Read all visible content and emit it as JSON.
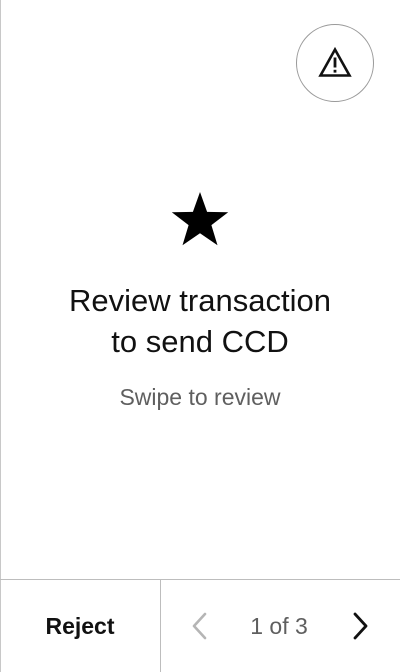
{
  "warning": {
    "icon": "warning-triangle-icon"
  },
  "hero": {
    "icon": "star-icon",
    "title_line1": "Review transaction",
    "title_line2": "to send CCD",
    "subtitle": "Swipe to review"
  },
  "footer": {
    "reject_label": "Reject",
    "prev_icon": "chevron-left-icon",
    "next_icon": "chevron-right-icon",
    "page_indicator": "1 of 3",
    "current_page": 1,
    "total_pages": 3
  },
  "colors": {
    "text": "#111111",
    "muted_text": "#5f5f5f",
    "border": "#bdbdbd",
    "disabled_chevron": "#b5b5b5"
  }
}
